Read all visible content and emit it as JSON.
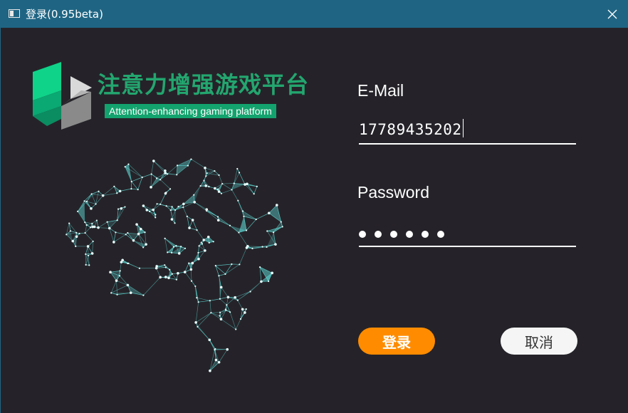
{
  "window": {
    "title": "登录(0.95beta)",
    "close_icon": "close-icon"
  },
  "brand": {
    "name_cn": "注意力增强游戏平台",
    "name_en": "Attention-enhancing gaming platform",
    "colors": {
      "primary": "#23a66f",
      "badge_bg": "#13a36e",
      "logo_green": "#0fd389",
      "logo_grey": "#8a8a8a"
    }
  },
  "illustration": {
    "icon": "brain-network-icon",
    "color": "#5fd6d2"
  },
  "form": {
    "email_label": "E-Mail",
    "email_value": "17789435202",
    "password_label": "Password",
    "password_length": 6
  },
  "buttons": {
    "login_label": "登录",
    "cancel_label": "取消",
    "login_color": "#ff8c00",
    "cancel_color": "#f5f5f5"
  },
  "theme": {
    "titlebar": "#1f6583",
    "background": "#252329"
  }
}
